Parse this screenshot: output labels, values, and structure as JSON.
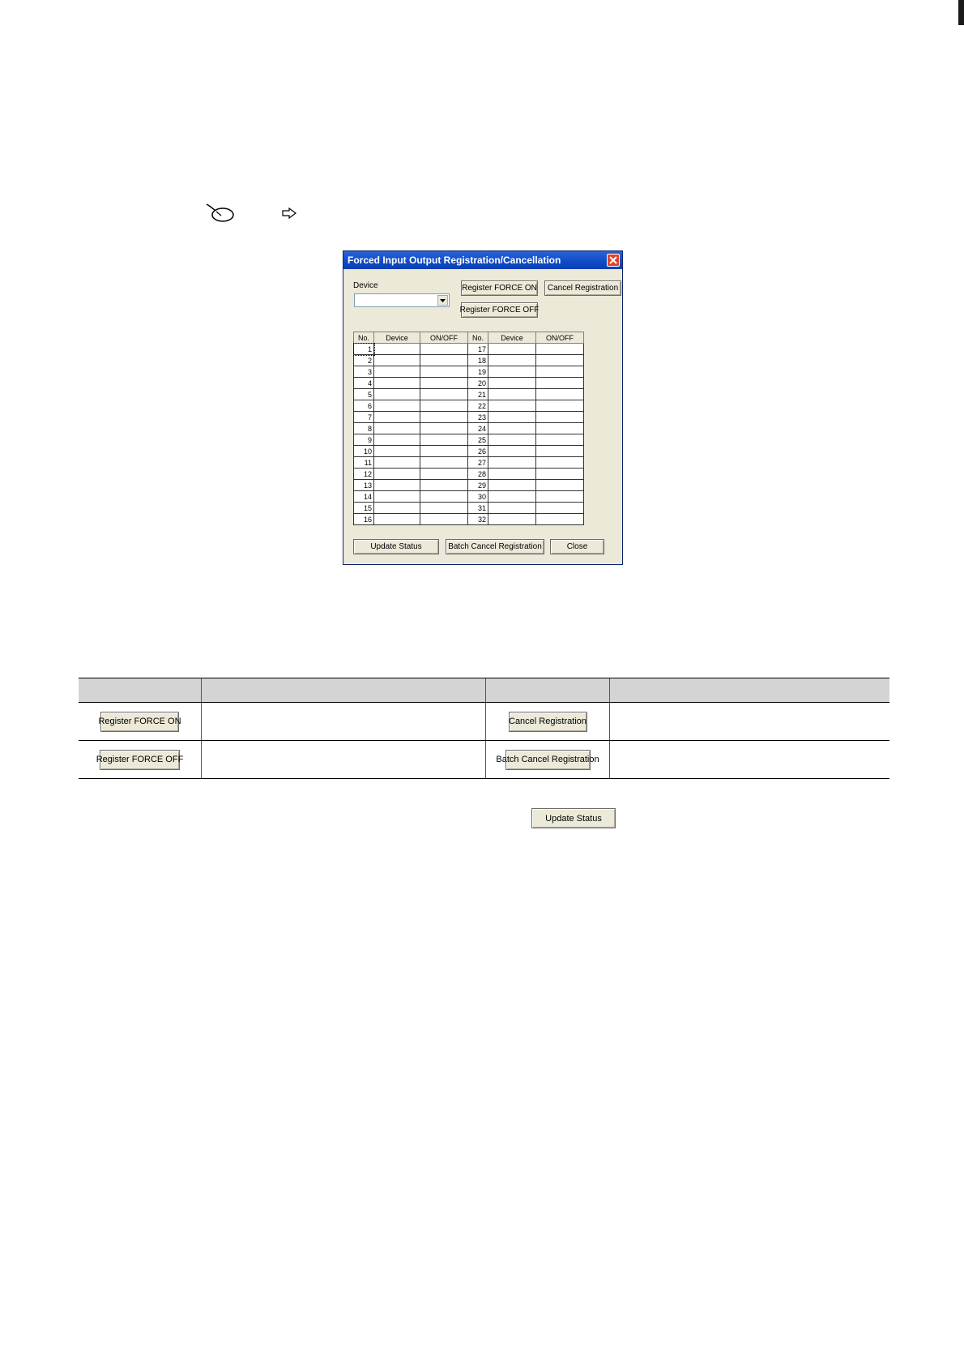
{
  "dialog": {
    "title": "Forced Input Output Registration/Cancellation",
    "device_label": "Device",
    "buttons": {
      "register_on": "Register FORCE ON",
      "cancel_registration": "Cancel Registration",
      "register_off": "Register FORCE OFF",
      "update_status": "Update Status",
      "batch_cancel": "Batch Cancel Registration",
      "close": "Close"
    },
    "table": {
      "headers": [
        "No.",
        "Device",
        "ON/OFF",
        "No.",
        "Device",
        "ON/OFF"
      ],
      "left_numbers": [
        "1",
        "2",
        "3",
        "4",
        "5",
        "6",
        "7",
        "8",
        "9",
        "10",
        "11",
        "12",
        "13",
        "14",
        "15",
        "16"
      ],
      "right_numbers": [
        "17",
        "18",
        "19",
        "20",
        "21",
        "22",
        "23",
        "24",
        "25",
        "26",
        "27",
        "28",
        "29",
        "30",
        "31",
        "32"
      ]
    }
  },
  "reference_table": {
    "row1_left_button": "Register FORCE ON",
    "row1_right_button": "Cancel Registration",
    "row2_left_button": "Register FORCE OFF",
    "row2_right_button": "Batch Cancel Registration"
  },
  "update_status_button": "Update Status",
  "icons": {
    "mouse": "mouse-icon",
    "arrow": "right-arrow-icon",
    "close": "close-icon",
    "dropdown": "chevron-down-icon"
  }
}
